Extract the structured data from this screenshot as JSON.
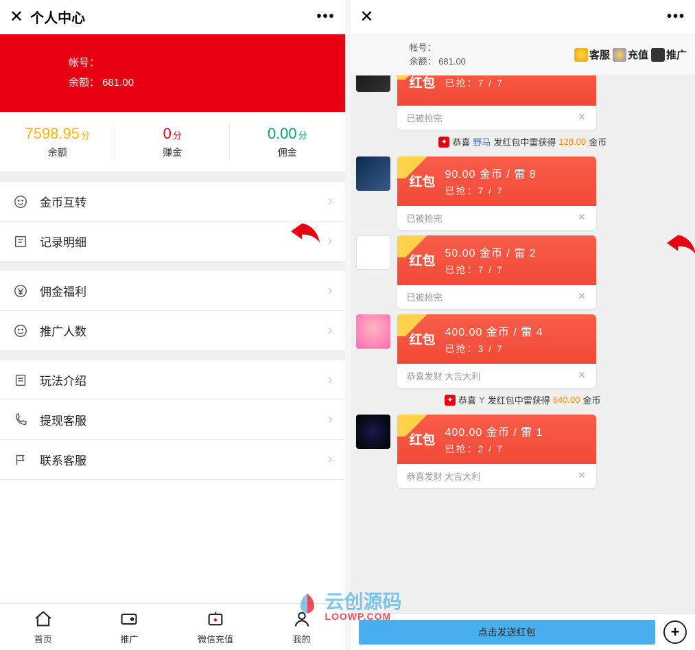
{
  "left": {
    "title": "个人中心",
    "account_lbl": "帐号：",
    "balance_lbl": "余额：",
    "balance_val": "681.00",
    "stats": [
      {
        "val": "7598.95",
        "unit": "分",
        "lbl": "余额",
        "cls": "yellow"
      },
      {
        "val": "0",
        "unit": "分",
        "lbl": "赚金",
        "cls": "redc"
      },
      {
        "val": "0.00",
        "unit": "分",
        "lbl": "佣金",
        "cls": "green"
      }
    ],
    "menu1": [
      "金币互转",
      "记录明细"
    ],
    "menu2": [
      "佣金福利",
      "推广人数"
    ],
    "menu3": [
      "玩法介绍",
      "提现客服",
      "联系客服"
    ],
    "tabs": [
      "首页",
      "推广",
      "微信充值",
      "我的"
    ]
  },
  "right": {
    "account_lbl": "帐号：",
    "balance_lbl": "余额：",
    "balance_val": "681.00",
    "btns": [
      "客服",
      "充值",
      "推广"
    ],
    "envelopes": [
      {
        "line1": "",
        "line2": "已抢：7 / 7",
        "foot": "已被抢完",
        "av": "av1"
      },
      {
        "line1": "90.00 金币 / 雷 8",
        "line2": "已抢：7 / 7",
        "foot": "已被抢完",
        "av": "av2",
        "notice_before": true
      },
      {
        "line1": "50.00 金币 / 雷 2",
        "line2": "已抢：7 / 7",
        "foot": "已被抢完",
        "av": "av3"
      },
      {
        "line1": "400.00 金币 / 雷 4",
        "line2": "已抢：3 / 7",
        "foot": "恭喜发财 大吉大利",
        "av": "av4",
        "notice_after": true
      },
      {
        "line1": "400.00 金币 / 雷 1",
        "line2": "已抢：2 / 7",
        "foot": "恭喜发财 大吉大利",
        "av": "av5"
      }
    ],
    "notice1": {
      "pre": "恭喜",
      "name": "野马",
      "mid": "发红包中雷获得",
      "amt": "128.00",
      "suf": "金币"
    },
    "notice2": {
      "pre": "恭喜",
      "name": "Y",
      "mid": "发红包中雷获得",
      "amt": "640.00",
      "suf": "金币"
    },
    "badge": "红包",
    "send": "点击发送红包"
  },
  "watermark": {
    "main": "云创源码",
    "sub": "LOOWP.COM"
  }
}
